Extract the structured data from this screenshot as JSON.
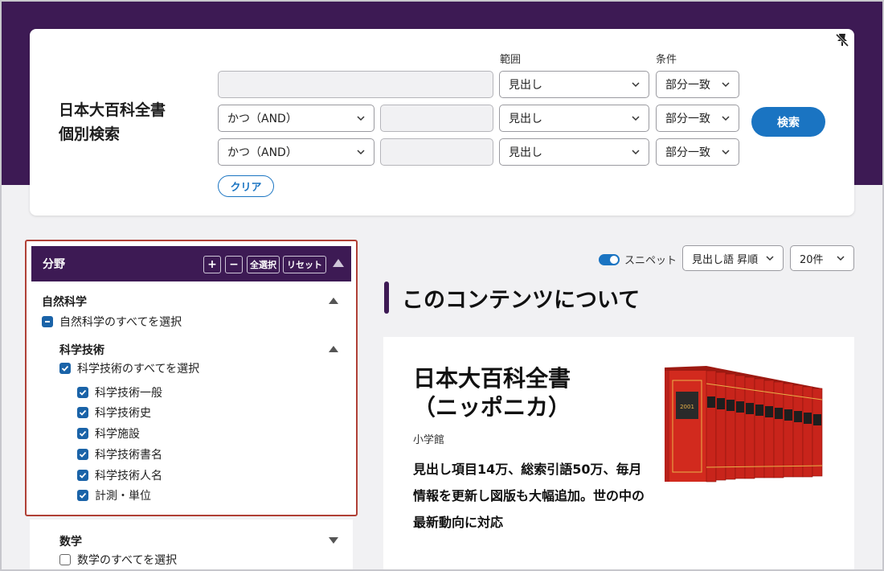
{
  "search": {
    "title_line1": "日本大百科全書",
    "title_line2": "個別検索",
    "range_label": "範囲",
    "condition_label": "条件",
    "rows": [
      {
        "operator": "",
        "keyword": "",
        "range": "見出し",
        "condition": "部分一致"
      },
      {
        "operator": "かつ（AND）",
        "keyword": "",
        "range": "見出し",
        "condition": "部分一致"
      },
      {
        "operator": "かつ（AND）",
        "keyword": "",
        "range": "見出し",
        "condition": "部分一致"
      }
    ],
    "search_button": "検索",
    "clear_button": "クリア"
  },
  "filter": {
    "title": "分野",
    "plus": "+",
    "minus": "−",
    "select_all": "全選択",
    "reset": "リセット",
    "group1": {
      "title": "自然科学",
      "select_all_label": "自然科学のすべてを選択",
      "sub": {
        "title": "科学技術",
        "select_all_label": "科学技術のすべてを選択",
        "items": [
          "科学技術一般",
          "科学技術史",
          "科学施設",
          "科学技術書名",
          "科学技術人名",
          "計測・単位"
        ]
      }
    },
    "group2": {
      "title": "数学",
      "select_all_label": "数学のすべてを選択"
    }
  },
  "results": {
    "snippet_label": "スニペット",
    "sort_label": "見出し語 昇順",
    "per_page_label": "20件",
    "section_title": "このコンテンツについて",
    "book_title_line1": "日本大百科全書",
    "book_title_line2": "（ニッポニカ）",
    "publisher": "小学館",
    "description": "見出し項目14万、総索引語50万、毎月情報を更新し図版も大幅追加。世の中の最新動向に対応"
  },
  "colors": {
    "brand_purple": "#3d1a54",
    "accent_blue": "#1a74c2",
    "highlight_border": "#b04036",
    "book_red": "#d22a1e"
  }
}
